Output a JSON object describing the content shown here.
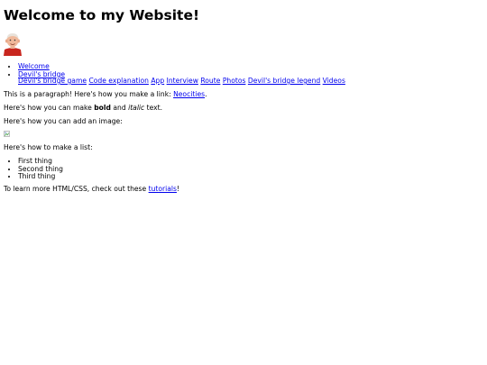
{
  "page": {
    "title": "Welcome to my Website!",
    "avatar_icon": "cartoon-head-avatar-icon",
    "nav": [
      {
        "label": "Welcome"
      },
      {
        "label": "Devil's bridge"
      }
    ],
    "sub_links": [
      {
        "label": "Devil's bridge game"
      },
      {
        "label": "Code explanation"
      },
      {
        "label": "App"
      },
      {
        "label": "Interview"
      },
      {
        "label": "Route"
      },
      {
        "label": "Photos"
      },
      {
        "label": "Devil's bridge legend"
      },
      {
        "label": "Videos"
      }
    ],
    "para1": {
      "before": "This is a paragraph! Here's how you make a link: ",
      "link": "Neocities",
      "after": "."
    },
    "para2": {
      "before": "Here's how you can make ",
      "bold": "bold",
      "mid": " and ",
      "italic": "italic",
      "after": " text."
    },
    "para3": "Here's how you can add an image:",
    "image_icon": "broken-image-icon",
    "para4": "Here's how to make a list:",
    "list_items": [
      "First thing",
      "Second thing",
      "Third thing"
    ],
    "para5": {
      "before": "To learn more HTML/CSS, check out these ",
      "link": "tutorials",
      "after": "!"
    },
    "colors": {
      "link": "#0000ee",
      "text": "#000000",
      "background": "#ffffff"
    }
  }
}
